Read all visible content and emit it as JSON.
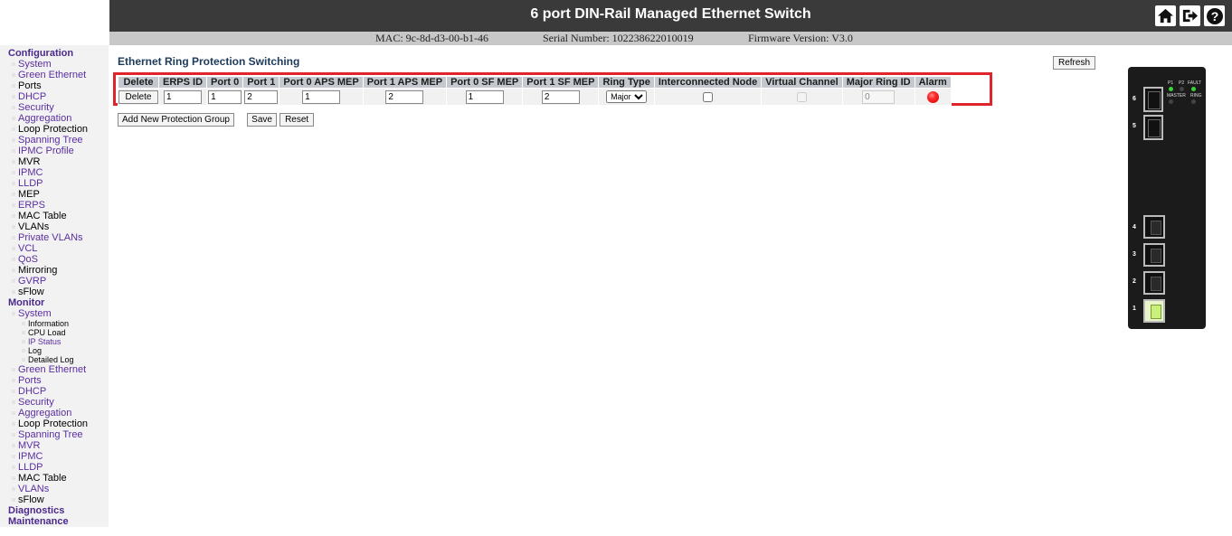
{
  "header": {
    "title": "6 port DIN-Rail Managed Ethernet Switch",
    "mac": "MAC: 9c-8d-d3-00-b1-46",
    "serial": "Serial Number: 102238622010019",
    "firmware": "Firmware Version: V3.0",
    "icons": [
      "home-icon",
      "logout-icon",
      "help-icon"
    ]
  },
  "sidebar": {
    "configuration": {
      "label": "Configuration",
      "items": [
        "System",
        "Green Ethernet",
        "Ports",
        "DHCP",
        "Security",
        "Aggregation",
        "Loop Protection",
        "Spanning Tree",
        "IPMC Profile",
        "MVR",
        "IPMC",
        "LLDP",
        "MEP",
        "ERPS",
        "MAC Table",
        "VLANs",
        "Private VLANs",
        "VCL",
        "QoS",
        "Mirroring",
        "GVRP",
        "sFlow"
      ]
    },
    "monitor": {
      "label": "Monitor",
      "system": "System",
      "system_items": [
        "Information",
        "CPU Load",
        "IP Status",
        "Log",
        "Detailed Log"
      ],
      "items": [
        "Green Ethernet",
        "Ports",
        "DHCP",
        "Security",
        "Aggregation",
        "Loop Protection",
        "Spanning Tree",
        "MVR",
        "IPMC",
        "LLDP",
        "MAC Table",
        "VLANs",
        "sFlow"
      ]
    },
    "diagnostics": "Diagnostics",
    "maintenance": "Maintenance"
  },
  "main": {
    "title": "Ethernet Ring Protection Switching",
    "refresh_label": "Refresh",
    "columns": [
      "Delete",
      "ERPS ID",
      "Port 0",
      "Port 1",
      "Port 0 APS MEP",
      "Port 1 APS MEP",
      "Port 0 SF MEP",
      "Port 1 SF MEP",
      "Ring Type",
      "Interconnected Node",
      "Virtual Channel",
      "Major Ring ID",
      "Alarm"
    ],
    "row": {
      "delete_label": "Delete",
      "erps_id": "1",
      "port0": "1",
      "port1": "2",
      "port0_aps_mep": "1",
      "port1_aps_mep": "2",
      "port0_sf_mep": "1",
      "port1_sf_mep": "2",
      "ring_type": "Major",
      "interconnected_node": false,
      "virtual_channel": false,
      "major_ring_id": "0",
      "alarm_color": "#ff2a2a"
    },
    "add_group_label": "Add New Protection Group",
    "save_label": "Save",
    "reset_label": "Reset"
  },
  "device": {
    "led_labels": [
      "P1",
      "P2",
      "FAULT",
      "MASTER",
      "RING"
    ],
    "port_labels": [
      "6",
      "5",
      "4",
      "3",
      "2",
      "1"
    ],
    "led_green": "#39d339"
  }
}
